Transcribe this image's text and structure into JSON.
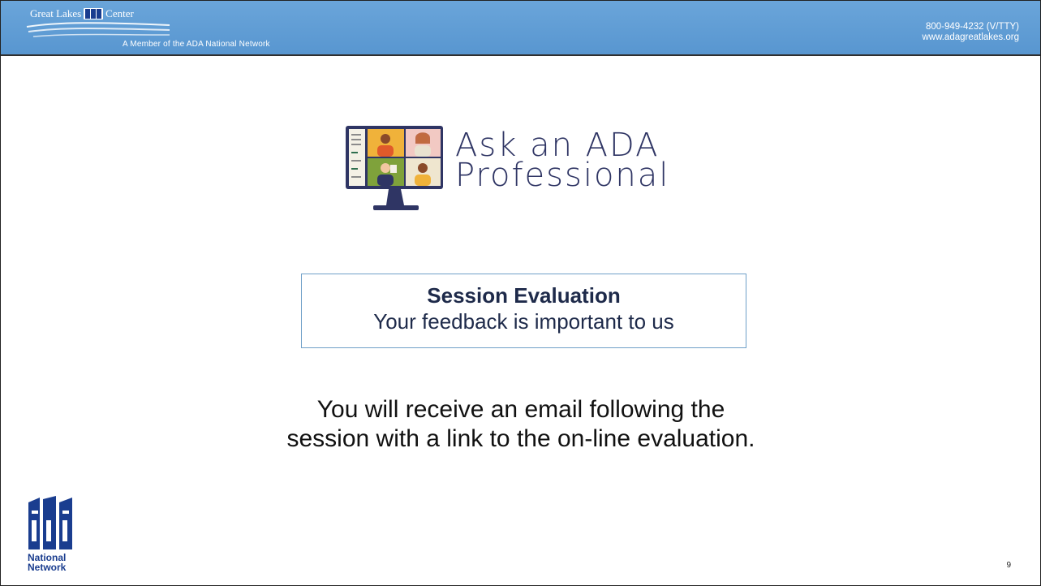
{
  "header": {
    "org_name_left": "Great Lakes",
    "org_name_right": "Center",
    "member_text": "A Member of the ADA National Network",
    "phone": "800-949-4232 (V/TTY)",
    "website": "www.adagreatlakes.org"
  },
  "logo": {
    "line1": "Ask an ADA",
    "line2": "Professional"
  },
  "evaluation": {
    "title": "Session Evaluation",
    "subtitle": "Your feedback is important to us"
  },
  "message": {
    "line1": "You will receive an email following the",
    "line2": "session with a link to the on-line evaluation."
  },
  "footer": {
    "network_line1": "National",
    "network_line2": "Network",
    "page_number": "9"
  },
  "colors": {
    "header": "#5b9bd5",
    "logo_text": "#2f3564",
    "ada_blue": "#1a3d8f",
    "eval_border": "#6fa0c8"
  }
}
